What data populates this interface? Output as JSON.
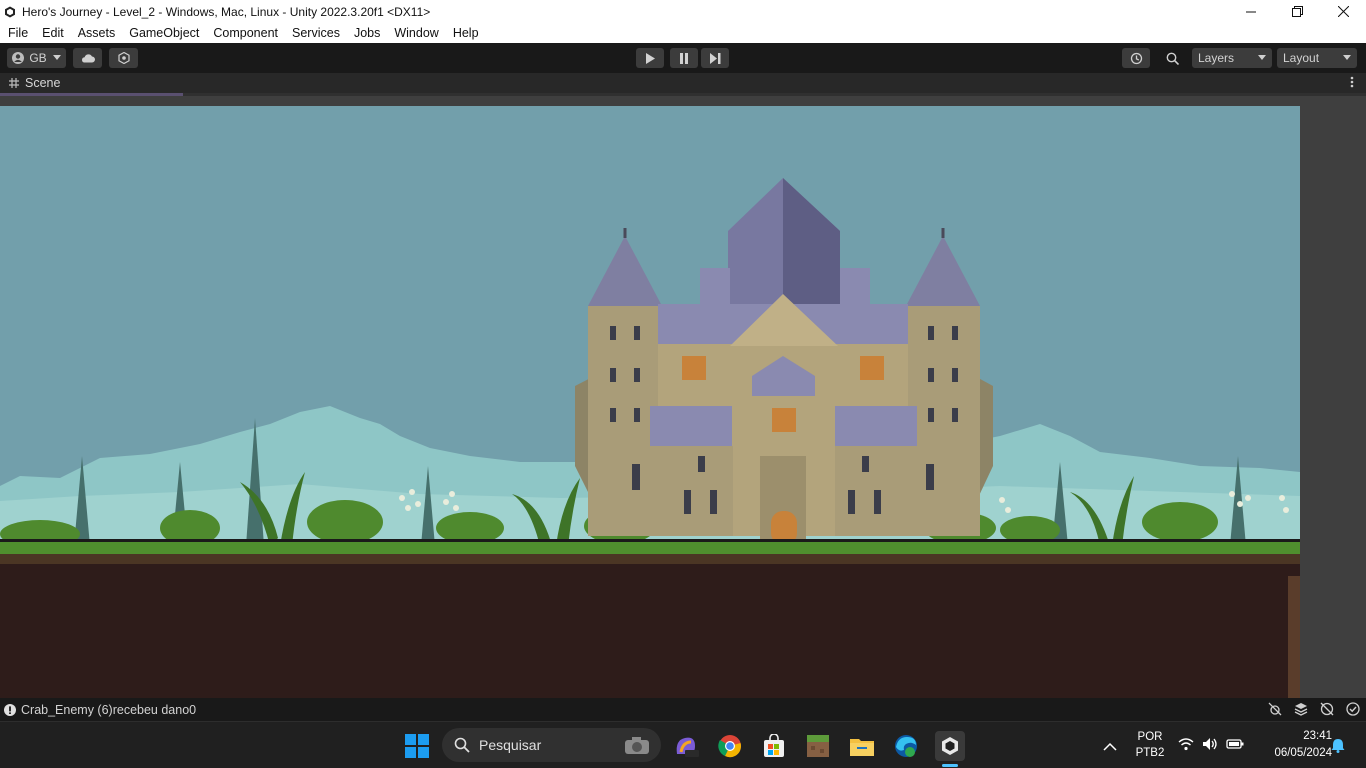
{
  "window": {
    "title": "Hero's Journey - Level_2 - Windows, Mac, Linux - Unity 2022.3.20f1 <DX11>",
    "app_icon": "unity-icon",
    "controls": [
      "minimize-icon",
      "restore-icon",
      "close-icon"
    ]
  },
  "menu": {
    "items": [
      {
        "label": "File"
      },
      {
        "label": "Edit"
      },
      {
        "label": "Assets"
      },
      {
        "label": "GameObject"
      },
      {
        "label": "Component"
      },
      {
        "label": "Services"
      },
      {
        "label": "Jobs"
      },
      {
        "label": "Window"
      },
      {
        "label": "Help"
      }
    ]
  },
  "toolbar": {
    "account_label": "GB",
    "layers_label": "Layers",
    "layout_label": "Layout",
    "play_icon": "play-icon",
    "pause_icon": "pause-icon",
    "step_icon": "step-icon",
    "history_icon": "history-icon",
    "search_icon": "search-icon"
  },
  "scene": {
    "tab_label": "Scene",
    "colors": {
      "sky": "#729fab",
      "grass": "#4f8f2e",
      "dirt": "#2e1c1a",
      "stone": "#a99c78",
      "roof": "#7f7fa1"
    }
  },
  "status": {
    "message": "Crab_Enemy (6)recebeu dano0"
  },
  "taskbar": {
    "search_placeholder": "Pesquisar",
    "apps": [
      "windows-start-icon",
      "copilot-icon",
      "chrome-icon",
      "store-icon",
      "minecraft-icon",
      "file-explorer-icon",
      "edge-icon",
      "unity-hub-icon"
    ],
    "lang_top": "POR",
    "lang_bottom": "PTB2",
    "time": "23:41",
    "date": "06/05/2024"
  }
}
